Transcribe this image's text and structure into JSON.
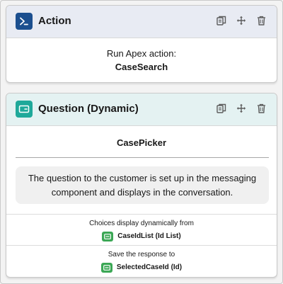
{
  "action_card": {
    "title": "Action",
    "icon": "apex-icon",
    "header_color": "#e8ebf3",
    "icon_color": "#1b4f8f",
    "line1": "Run Apex action:",
    "line2": "CaseSearch"
  },
  "question_card": {
    "title": "Question (Dynamic)",
    "icon": "question-icon",
    "header_color": "#e4f2f2",
    "icon_color": "#1fa99a",
    "name": "CasePicker",
    "bubble_text": "The question to the customer is set up in the messaging component and displays in the conversation.",
    "choices_label": "Choices display dynamically from",
    "choices_value": "CaseIdList (Id List)",
    "save_label": "Save the response to",
    "save_value": "SelectedCaseId (Id)",
    "variable_icon_color": "#3ba755"
  },
  "tools": [
    "copy-icon",
    "move-icon",
    "delete-icon"
  ]
}
